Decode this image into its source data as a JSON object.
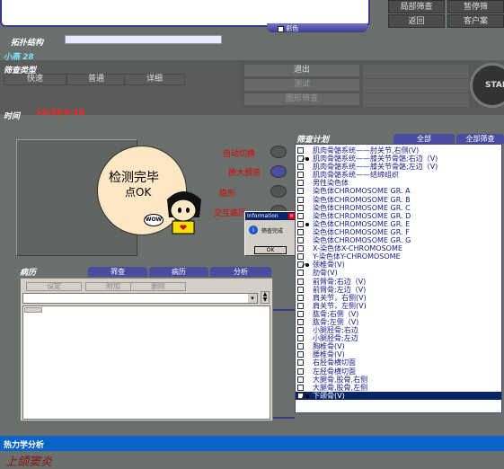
{
  "top": {
    "color_checkbox_label": "彩色",
    "topology_label": "拓扑结构",
    "buttons": [
      "局部筛查",
      "暂停筛",
      "返回",
      "客户案"
    ]
  },
  "patient": {
    "name": "小燕 28"
  },
  "screen_type": {
    "label": "筛查类型",
    "options": [
      "快速",
      "普通",
      "详细"
    ]
  },
  "right_controls": {
    "exit": "退出",
    "test": "测试",
    "graphic": "图形筛查",
    "start": "STAR"
  },
  "time": {
    "label": "时间",
    "value": "10:59/0:10"
  },
  "detect": {
    "line1": "检测完毕",
    "line2": "点OK"
  },
  "options": [
    "自动切换",
    "放大预览",
    "隐形",
    "交互病历"
  ],
  "dialog": {
    "title": "Information",
    "message": "筛查完成",
    "ok": "OK"
  },
  "screen_plan": {
    "label": "筛查计划",
    "tab_all": "全部",
    "tab_all_detect": "全部筛查",
    "items": [
      {
        "text": "肌肉骨骼系统——肘关节,右侧(V)",
        "checked": false,
        "dot": false
      },
      {
        "text": "肌肉骨骼系统——膝关节骨骼;右边（V)",
        "checked": true,
        "dot": true
      },
      {
        "text": "肌肉骨骼系统——膝关节骨骼;左边（V)",
        "checked": false,
        "dot": false
      },
      {
        "text": "肌肉骨骼系统——结缔组织",
        "checked": false,
        "dot": false
      },
      {
        "text": "男性染色体",
        "checked": false,
        "dot": false
      },
      {
        "text": "染色体CHROMOSOME GR. A",
        "checked": false,
        "dot": false
      },
      {
        "text": "染色体CHROMOSOME GR. B",
        "checked": false,
        "dot": false
      },
      {
        "text": "染色体CHROMOSOME GR. C",
        "checked": false,
        "dot": false
      },
      {
        "text": "染色体CHROMOSOME GR. D",
        "checked": false,
        "dot": false
      },
      {
        "text": "染色体CHROMOSOME GR. E",
        "checked": false,
        "dot": true
      },
      {
        "text": "染色体CHROMOSOME GR. F",
        "checked": false,
        "dot": false
      },
      {
        "text": "染色体CHROMOSOME GR. G",
        "checked": false,
        "dot": false
      },
      {
        "text": "X-染色体X-CHROMOSOME",
        "checked": false,
        "dot": false
      },
      {
        "text": "Y-染色体Y-CHROMOSOME",
        "checked": false,
        "dot": false
      },
      {
        "text": "颈椎骨(V)",
        "checked": true,
        "dot": true
      },
      {
        "text": "肋骨(V)",
        "checked": false,
        "dot": false
      },
      {
        "text": "前臂骨;右边（V)",
        "checked": false,
        "dot": false
      },
      {
        "text": "前臂骨;左边（V)",
        "checked": false,
        "dot": false
      },
      {
        "text": "肩关节，右侧(V)",
        "checked": false,
        "dot": false
      },
      {
        "text": "肩关节，左侧(V)",
        "checked": false,
        "dot": false
      },
      {
        "text": "肱骨;右侧（V)",
        "checked": false,
        "dot": false
      },
      {
        "text": "肱骨;左侧（V)",
        "checked": false,
        "dot": false
      },
      {
        "text": "小腿胫骨;右边",
        "checked": false,
        "dot": false
      },
      {
        "text": "小腿胫骨;左边",
        "checked": false,
        "dot": false
      },
      {
        "text": "胸椎骨(V)",
        "checked": false,
        "dot": false
      },
      {
        "text": "腰椎骨(V)",
        "checked": false,
        "dot": false
      },
      {
        "text": "右胫骨横切面",
        "checked": false,
        "dot": false
      },
      {
        "text": "左胫骨横切面",
        "checked": false,
        "dot": false
      },
      {
        "text": "大腿骨,股骨,右侧",
        "checked": false,
        "dot": false
      },
      {
        "text": "大腿骨,股骨,左侧",
        "checked": false,
        "dot": false
      },
      {
        "text": "下颌骨(V)",
        "checked": true,
        "dot": true,
        "selected": true
      }
    ]
  },
  "medical_record": {
    "label": "病历",
    "tabs": [
      "筛查",
      "病历",
      "分析"
    ],
    "buttons": [
      "设定",
      "附加",
      "删除"
    ]
  },
  "analysis_bar": {
    "label": "热力学分析"
  },
  "footer": {
    "text": "上颌窦炎"
  },
  "colors": {
    "accent": "#3b3a8c",
    "bottom_bar": "#0a64c8",
    "time_value": "#ff2020"
  }
}
